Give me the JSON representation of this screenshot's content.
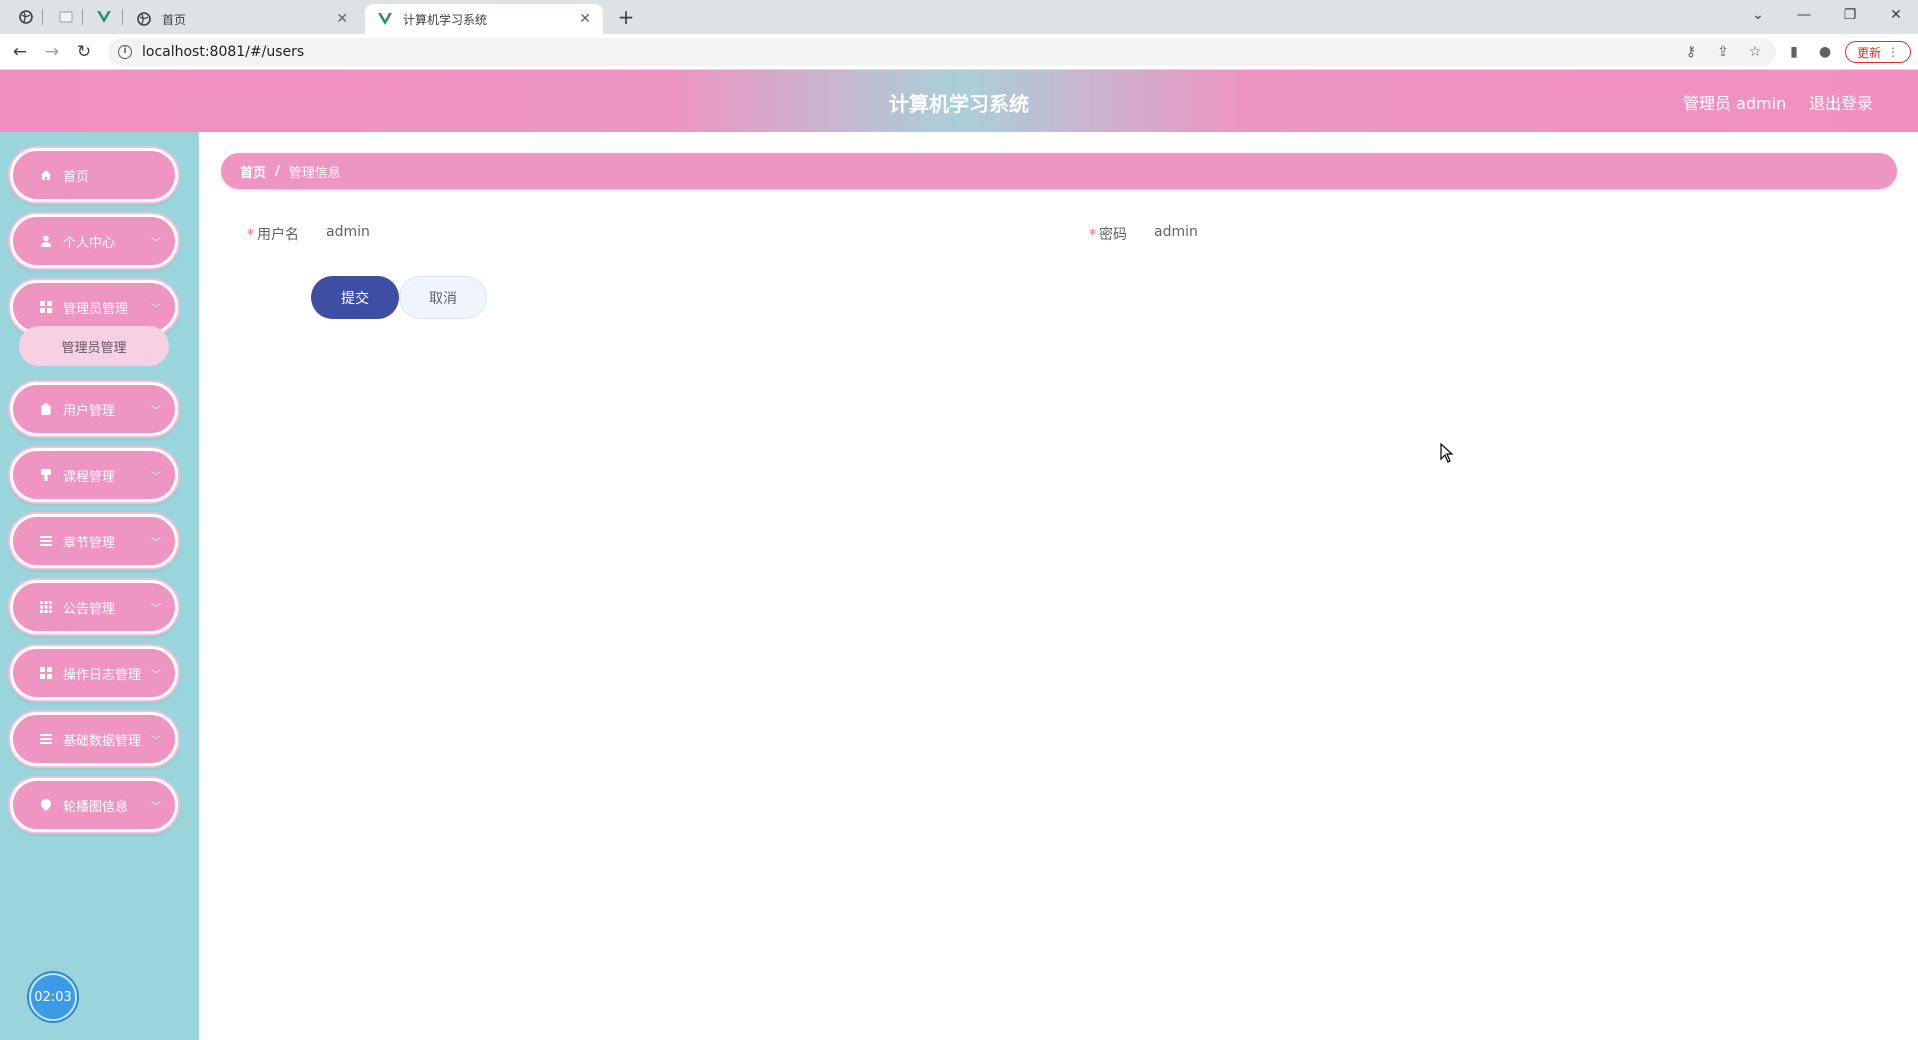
{
  "browser": {
    "tabs": [
      {
        "title": "首页",
        "favicon": "globe-icon",
        "active": false
      },
      {
        "title": "计算机学习系统",
        "favicon": "vue-logo-icon",
        "active": true
      }
    ],
    "url": "localhost:8081/#/users",
    "update_label": "更新"
  },
  "header": {
    "title": "计算机学习系统",
    "user": "管理员 admin",
    "logout": "退出登录"
  },
  "sidebar": {
    "items": [
      {
        "label": "首页",
        "icon": "home-icon",
        "has_arrow": false
      },
      {
        "label": "个人中心",
        "icon": "user-icon",
        "has_arrow": true
      },
      {
        "label": "管理员管理",
        "icon": "grid-icon",
        "has_arrow": true
      },
      {
        "label": "用户管理",
        "icon": "clipboard-icon",
        "has_arrow": true
      },
      {
        "label": "课程管理",
        "icon": "brush-icon",
        "has_arrow": true
      },
      {
        "label": "章节管理",
        "icon": "list-icon",
        "has_arrow": true
      },
      {
        "label": "公告管理",
        "icon": "apps-icon",
        "has_arrow": true
      },
      {
        "label": "操作日志管理",
        "icon": "grid-icon",
        "has_arrow": true
      },
      {
        "label": "基础数据管理",
        "icon": "list-icon",
        "has_arrow": true
      },
      {
        "label": "轮播图信息",
        "icon": "location-icon",
        "has_arrow": true
      }
    ],
    "submenu": {
      "label": "管理员管理"
    },
    "timer": "02:03"
  },
  "breadcrumb": {
    "home": "首页",
    "separator": "/",
    "current": "管理信息"
  },
  "form": {
    "username_label": "用户名",
    "username_value": "admin",
    "password_label": "密码",
    "password_value": "admin",
    "required_mark": "*",
    "submit": "提交",
    "cancel": "取消"
  },
  "colors": {
    "header_pink": "#f190c0",
    "sidebar_teal": "#9ad5dc",
    "submit_blue": "#3e4fa3"
  }
}
